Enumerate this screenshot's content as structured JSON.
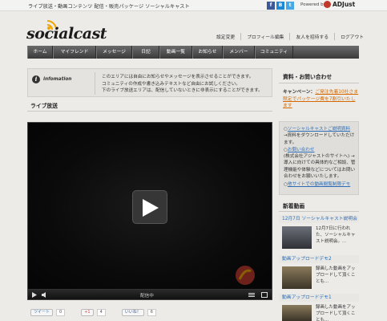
{
  "header": {
    "tagline": "ライブ放送・動画コンテンツ 配信・販売パッケージ ソーシャルキャスト",
    "powered_by": "Powered by",
    "brand": "ADJust",
    "logo_text": "socialcast",
    "social_icons": [
      "facebook-icon",
      "hatena-bookmark-icon",
      "twitter-icon"
    ],
    "util_nav": [
      "設定変更",
      "プロフィール編集",
      "友人を招待する",
      "ログアウト"
    ]
  },
  "nav": {
    "items": [
      "ホーム",
      "マイフレンド",
      "メッセージ",
      "日記",
      "動画一覧",
      "お知らせ",
      "メンバー",
      "コミュニティ"
    ]
  },
  "info": {
    "title": "infomation",
    "lines": [
      "このエリアには自由にお知らせやメッセージを表示させることができます。",
      "コミュニティの作成や書き込みテキストなど自由にお試しください。",
      "下のライブ放送エリアは、配信していないときに非表示にすることができます。"
    ]
  },
  "live": {
    "title": "ライブ放送",
    "status": "配信中"
  },
  "share": {
    "tweet_label": "ツイート",
    "tweet_count": "0",
    "plus_label": "+1",
    "plus_count": "4",
    "like_label": "いいね！",
    "like_count": "6"
  },
  "sidebar": {
    "title": "資料・お問い合わせ",
    "campaign_label": "キャンペーン：",
    "campaign_text": "ご発注先着10社さま限定でパッケージ費を7割引いたします",
    "links": [
      {
        "link": "ソーシャルキャストご説明資料",
        "desc": "→資料をダウンロードしていただけます。"
      },
      {
        "link": "お問い合わせ",
        "desc": "(株式会社アジャストのサイトへ) →導入に向けての具体的なご相談、管理機能や体験などについてはお問い合わせをお願いいたします。"
      },
      {
        "link": "他サイトでの動画閲覧制限デモ",
        "desc": ""
      }
    ]
  },
  "news": {
    "title": "新着動画",
    "items": [
      {
        "head": "12月7日 ソーシャルキャスト説明会",
        "text": "12月7日に行われた、ソーシャルキャスト説明会。",
        "more": "..."
      },
      {
        "head": "動画アップロードデモ2",
        "text": "録画した動画をアップロードして頂くことも...",
        "more": ""
      },
      {
        "head": "動画アップロードデモ1",
        "text": "録画した動画をアップロードして頂くことも...",
        "more": ""
      }
    ]
  },
  "colors": {
    "accent_orange": "#d46a00",
    "link_blue": "#2a6db5",
    "nav_dark": "#3a3a3a"
  }
}
